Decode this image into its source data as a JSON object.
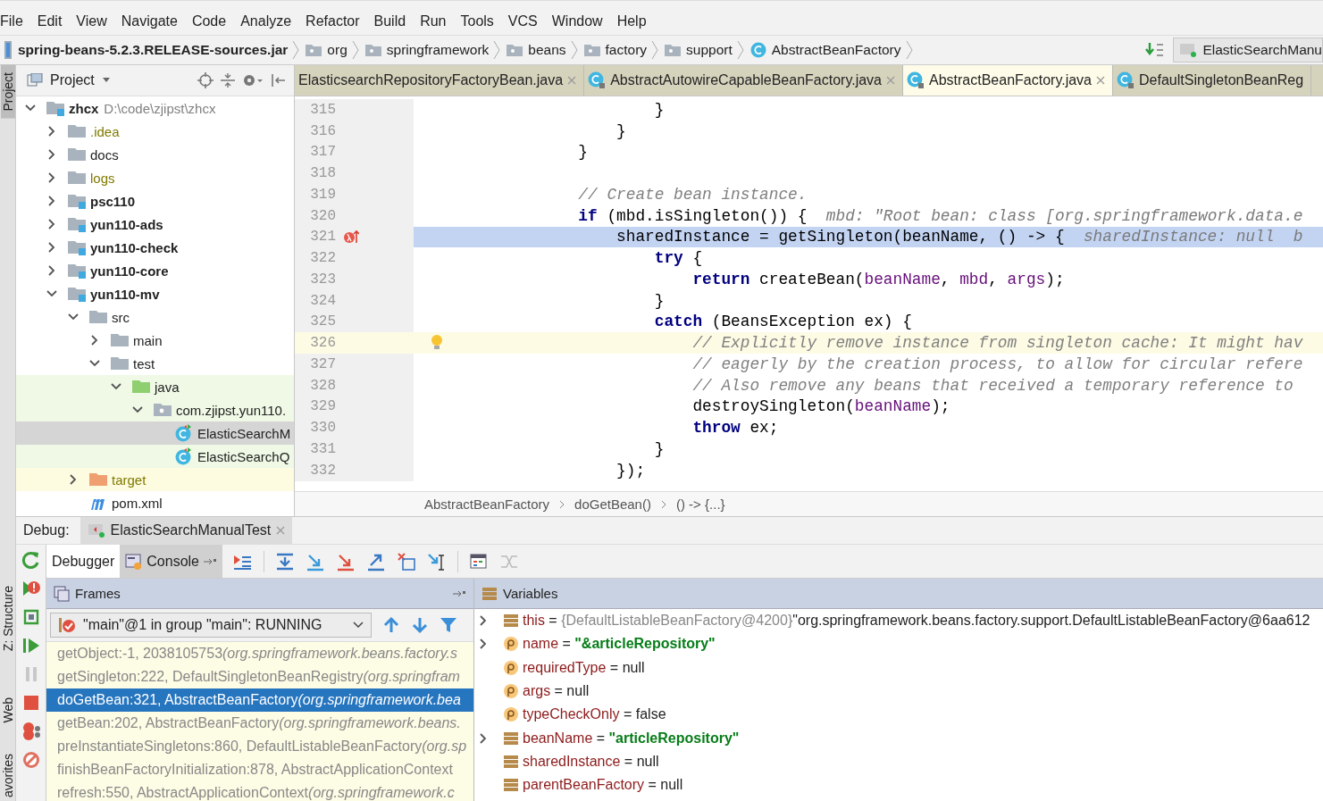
{
  "menu_bar": {
    "items": [
      "File",
      "Edit",
      "View",
      "Navigate",
      "Code",
      "Analyze",
      "Refactor",
      "Build",
      "Run",
      "Tools",
      "VCS",
      "Window",
      "Help"
    ]
  },
  "nav_bar": {
    "crumbs": [
      {
        "kind": "jar",
        "label": "spring-beans-5.2.3.RELEASE-sources.jar"
      },
      {
        "kind": "folder",
        "label": "org"
      },
      {
        "kind": "folder",
        "label": "springframework"
      },
      {
        "kind": "folder",
        "label": "beans"
      },
      {
        "kind": "folder",
        "label": "factory"
      },
      {
        "kind": "folder",
        "label": "support"
      },
      {
        "kind": "class",
        "label": "AbstractBeanFactory"
      }
    ],
    "run_config": "ElasticSearchManu"
  },
  "tool_stripe": {
    "top": [
      {
        "label": "Project",
        "selected": true
      }
    ],
    "bottom": [
      {
        "label": "Z: Structure",
        "selected": false
      },
      {
        "label": "Web",
        "selected": false
      },
      {
        "label": "avorites",
        "selected": false
      }
    ]
  },
  "project_panel": {
    "title": "Project",
    "tree": [
      {
        "kind": "module",
        "label": "zhcx",
        "detail": "D:\\code\\zjipst\\zhcx",
        "expanded": true,
        "selected": false,
        "children": [
          {
            "kind": "ignored-folder",
            "label": ".idea",
            "expanded": false,
            "selected": false
          },
          {
            "kind": "folder",
            "label": "docs",
            "expanded": false,
            "selected": false
          },
          {
            "kind": "ignored-folder",
            "label": "logs",
            "expanded": false,
            "selected": false
          },
          {
            "kind": "module",
            "label": "psc110",
            "expanded": false,
            "selected": false
          },
          {
            "kind": "module",
            "label": "yun110-ads",
            "expanded": false,
            "selected": false
          },
          {
            "kind": "module",
            "label": "yun110-check",
            "expanded": false,
            "selected": false
          },
          {
            "kind": "module",
            "label": "yun110-core",
            "expanded": false,
            "selected": false
          },
          {
            "kind": "module",
            "label": "yun110-mv",
            "expanded": true,
            "selected": false,
            "children": [
              {
                "kind": "folder",
                "label": "src",
                "expanded": true,
                "selected": false,
                "children": [
                  {
                    "kind": "folder",
                    "label": "main",
                    "expanded": false,
                    "selected": false
                  },
                  {
                    "kind": "folder",
                    "label": "test",
                    "expanded": true,
                    "selected": false,
                    "children": [
                      {
                        "kind": "test-source-folder",
                        "label": "java",
                        "expanded": true,
                        "selected": false,
                        "children": [
                          {
                            "kind": "test-package",
                            "label": "com.zjipst.yun110.",
                            "expanded": true,
                            "selected": false,
                            "children": [
                              {
                                "kind": "test-class",
                                "label": "ElasticSearchM",
                                "selected": true
                              },
                              {
                                "kind": "test-class",
                                "label": "ElasticSearchQ",
                                "selected": false
                              }
                            ]
                          }
                        ]
                      }
                    ]
                  }
                ]
              },
              {
                "kind": "excluded-folder",
                "label": "target",
                "expanded": false,
                "selected": false
              },
              {
                "kind": "maven-file",
                "label": "pom.xml",
                "selected": false
              }
            ]
          }
        ]
      }
    ]
  },
  "editor": {
    "tabs": [
      {
        "kind": "plain",
        "label": "ElasticsearchRepositoryFactoryBean.java",
        "selected": false,
        "closable": true
      },
      {
        "kind": "class",
        "label": "AbstractAutowireCapableBeanFactory.java",
        "selected": false,
        "closable": true
      },
      {
        "kind": "class",
        "label": "AbstractBeanFactory.java",
        "selected": true,
        "closable": true
      },
      {
        "kind": "class",
        "label": "DefaultSingletonBeanReg",
        "selected": false,
        "closable": false
      }
    ],
    "lines": [
      {
        "number": "315",
        "kind": "plain",
        "segments": [
          {
            "kind": "plain",
            "text": "                }"
          }
        ]
      },
      {
        "number": "316",
        "kind": "plain",
        "segments": [
          {
            "kind": "plain",
            "text": "            }"
          }
        ]
      },
      {
        "number": "317",
        "kind": "plain",
        "segments": [
          {
            "kind": "plain",
            "text": "        }"
          }
        ]
      },
      {
        "number": "318",
        "kind": "plain"
      },
      {
        "number": "319",
        "kind": "plain",
        "segments": [
          {
            "kind": "comment",
            "text": "        // Create bean instance."
          }
        ]
      },
      {
        "number": "320",
        "kind": "plain",
        "segments": [
          {
            "kind": "keyword",
            "text": "        if"
          },
          {
            "kind": "plain",
            "text": " (mbd.isSingleton()) {  "
          },
          {
            "kind": "hint",
            "text": "mbd: \"Root bean: class [org.springframework.data.e"
          }
        ]
      },
      {
        "number": "321",
        "kind": "execution",
        "segments": [
          {
            "kind": "plain",
            "text": "            sharedInstance = getSingleton(beanName, () -> {  "
          },
          {
            "kind": "hint",
            "text": "sharedInstance: null  b"
          }
        ]
      },
      {
        "number": "322",
        "kind": "plain",
        "segments": [
          {
            "kind": "keyword",
            "text": "                try"
          },
          {
            "kind": "plain",
            "text": " {"
          }
        ]
      },
      {
        "number": "323",
        "kind": "plain",
        "segments": [
          {
            "kind": "keyword",
            "text": "                    return"
          },
          {
            "kind": "plain",
            "text": " createBean("
          },
          {
            "kind": "param",
            "text": "beanName"
          },
          {
            "kind": "plain",
            "text": ", "
          },
          {
            "kind": "param",
            "text": "mbd"
          },
          {
            "kind": "plain",
            "text": ", "
          },
          {
            "kind": "param",
            "text": "args"
          },
          {
            "kind": "plain",
            "text": ");"
          }
        ]
      },
      {
        "number": "324",
        "kind": "plain",
        "segments": [
          {
            "kind": "plain",
            "text": "                }"
          }
        ]
      },
      {
        "number": "325",
        "kind": "plain",
        "segments": [
          {
            "kind": "keyword",
            "text": "                catch"
          },
          {
            "kind": "plain",
            "text": " (BeansException ex) {"
          }
        ]
      },
      {
        "number": "326",
        "kind": "current",
        "segments": [
          {
            "kind": "comment",
            "text": "                    // Explicitly remove instance from singleton cache: It might hav"
          }
        ]
      },
      {
        "number": "327",
        "kind": "plain",
        "segments": [
          {
            "kind": "comment",
            "text": "                    // eagerly by the creation process, to allow for circular refere"
          }
        ]
      },
      {
        "number": "328",
        "kind": "plain",
        "segments": [
          {
            "kind": "comment",
            "text": "                    // Also remove any beans that received a temporary reference to"
          }
        ]
      },
      {
        "number": "329",
        "kind": "plain",
        "segments": [
          {
            "kind": "plain",
            "text": "                    destroySingleton("
          },
          {
            "kind": "param",
            "text": "beanName"
          },
          {
            "kind": "plain",
            "text": ");"
          }
        ]
      },
      {
        "number": "330",
        "kind": "plain",
        "segments": [
          {
            "kind": "keyword",
            "text": "                    throw"
          },
          {
            "kind": "plain",
            "text": " ex;"
          }
        ]
      },
      {
        "number": "331",
        "kind": "plain",
        "segments": [
          {
            "kind": "plain",
            "text": "                }"
          }
        ]
      },
      {
        "number": "332",
        "kind": "plain",
        "segments": [
          {
            "kind": "plain",
            "text": "            });"
          }
        ]
      }
    ],
    "breadcrumb": [
      "AbstractBeanFactory",
      "doGetBean()",
      "() -> {...}"
    ]
  },
  "debug": {
    "label": "Debug:",
    "session": "ElasticSearchManualTest",
    "tabs": [
      {
        "label": "Debugger",
        "selected": true
      },
      {
        "label": "Console",
        "selected": false
      }
    ],
    "frames": {
      "title": "Frames",
      "thread": "\"main\"@1 in group \"main\": RUNNING",
      "items": [
        {
          "method": "getObject:-1, 2038105753",
          "location": "(org.springframework.beans.factory.s",
          "selected": false
        },
        {
          "method": "getSingleton:222, DefaultSingletonBeanRegistry",
          "location": "(org.springfram",
          "selected": false
        },
        {
          "method": "doGetBean:321, AbstractBeanFactory",
          "location": "(org.springframework.bea",
          "selected": true
        },
        {
          "method": "getBean:202, AbstractBeanFactory",
          "location": "(org.springframework.beans.",
          "selected": false
        },
        {
          "method": "preInstantiateSingletons:860, DefaultListableBeanFactory",
          "location": "(org.sp",
          "selected": false
        },
        {
          "method": "finishBeanFactoryInitialization:878, AbstractApplicationContext",
          "selected": false
        },
        {
          "method": "refresh:550, AbstractApplicationContext",
          "location": "(org.springframework.c",
          "selected": false
        }
      ]
    },
    "variables": {
      "title": "Variables",
      "items": [
        {
          "kind": "field",
          "expandable": true,
          "name": "this",
          "op": "=",
          "ref": "{DefaultListableBeanFactory@4200}",
          "value": "\"org.springframework.beans.factory.support.DefaultListableBeanFactory@6aa612",
          "string_value": false
        },
        {
          "kind": "param",
          "expandable": true,
          "name": "name",
          "op": "=",
          "value": "\"&articleRepository\"",
          "string_value": true
        },
        {
          "kind": "param",
          "expandable": false,
          "name": "requiredType",
          "op": "=",
          "value": "null",
          "string_value": false
        },
        {
          "kind": "param",
          "expandable": false,
          "name": "args",
          "op": "=",
          "value": "null",
          "string_value": false
        },
        {
          "kind": "param",
          "expandable": false,
          "name": "typeCheckOnly",
          "op": "=",
          "value": "false",
          "string_value": false
        },
        {
          "kind": "field",
          "expandable": true,
          "name": "beanName",
          "op": "=",
          "value": "\"articleRepository\"",
          "string_value": true
        },
        {
          "kind": "field",
          "expandable": false,
          "name": "sharedInstance",
          "op": "=",
          "value": "null",
          "string_value": false
        },
        {
          "kind": "field",
          "expandable": false,
          "name": "parentBeanFactory",
          "op": "=",
          "value": "null",
          "string_value": false
        }
      ]
    }
  }
}
